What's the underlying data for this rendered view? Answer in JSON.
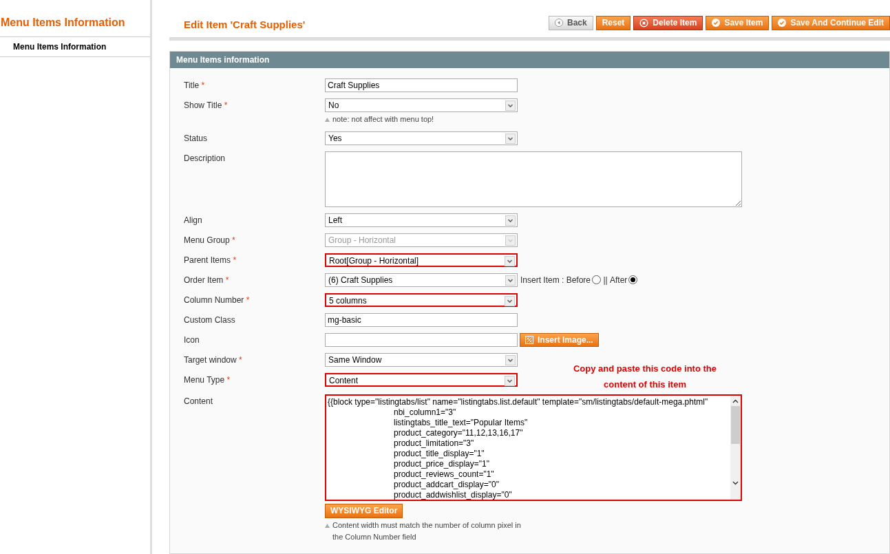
{
  "sidebar": {
    "title": "Menu Items Information",
    "items": [
      {
        "label": "Menu Items Information",
        "selected": true
      }
    ]
  },
  "header": {
    "title": "Edit Item 'Craft Supplies'",
    "buttons": [
      {
        "label": "Back",
        "kind": "back"
      },
      {
        "label": "Reset",
        "kind": "reset"
      },
      {
        "label": "Delete Item",
        "kind": "delete"
      },
      {
        "label": "Save Item",
        "kind": "save"
      },
      {
        "label": "Save And Continue Edit",
        "kind": "save"
      }
    ]
  },
  "section": {
    "title": "Menu Items information",
    "fields": [
      {
        "kind": "text",
        "label": "Title",
        "required_mark": "*",
        "value": "Craft Supplies"
      },
      {
        "kind": "select",
        "label": "Show Title",
        "required_mark": "*",
        "value": "No",
        "note": "note: not affect with menu top!"
      },
      {
        "kind": "select",
        "label": "Status",
        "value": "Yes"
      },
      {
        "kind": "textarea",
        "label": "Description"
      },
      {
        "kind": "select",
        "label": "Align",
        "value": "Left"
      },
      {
        "kind": "select",
        "label": "Menu Group",
        "required_mark": "*",
        "value": "Group - Horizontal",
        "disabled": true
      },
      {
        "kind": "select",
        "label": "Parent Items",
        "required_mark": "*",
        "value": "Root[Group - Horizontal]",
        "highlighted": true
      },
      {
        "kind": "select",
        "label": "Order Item",
        "required_mark": "*",
        "value": "(6) Craft Supplies",
        "insert": {
          "prefix": "Insert Item : ",
          "separator": " || ",
          "options": [
            {
              "label": "Before",
              "selected": false
            },
            {
              "label": "After",
              "selected": true
            }
          ]
        }
      },
      {
        "kind": "select",
        "label": "Column Number",
        "required_mark": "*",
        "value": "5 columns",
        "highlighted": true
      },
      {
        "kind": "text",
        "label": "Custom Class",
        "value": "mg-basic"
      },
      {
        "kind": "image",
        "label": "Icon",
        "button": "Insert Image..."
      },
      {
        "kind": "select",
        "label": "Target window",
        "required_mark": "*",
        "value": "Same Window"
      },
      {
        "kind": "select",
        "label": "Menu Type",
        "required_mark": "*",
        "value": "Content",
        "highlighted": true,
        "annotation": "Copy and paste this code into the content of this item"
      },
      {
        "kind": "content",
        "label": "Content",
        "highlighted": true,
        "first_line": "{{block type=\"listingtabs/list\" name=\"listingtabs.list.default\" template=\"sm/listingtabs/default-mega.phtml\"",
        "attribute_lines": [
          "nbi_column1=\"3\"",
          "listingtabs_title_text=\"Popular Items\"",
          "product_category=\"11,12,13,16,17\"",
          "product_limitation=\"3\"",
          "product_title_display=\"1\"",
          "product_price_display=\"1\"",
          "product_reviews_count=\"1\"",
          "product_addcart_display=\"0\"",
          "product_addwishlist_display=\"0\""
        ],
        "button": "WYSIWYG Editor",
        "note": "Content width must match the number of column pixel in the Column Number field"
      }
    ]
  }
}
